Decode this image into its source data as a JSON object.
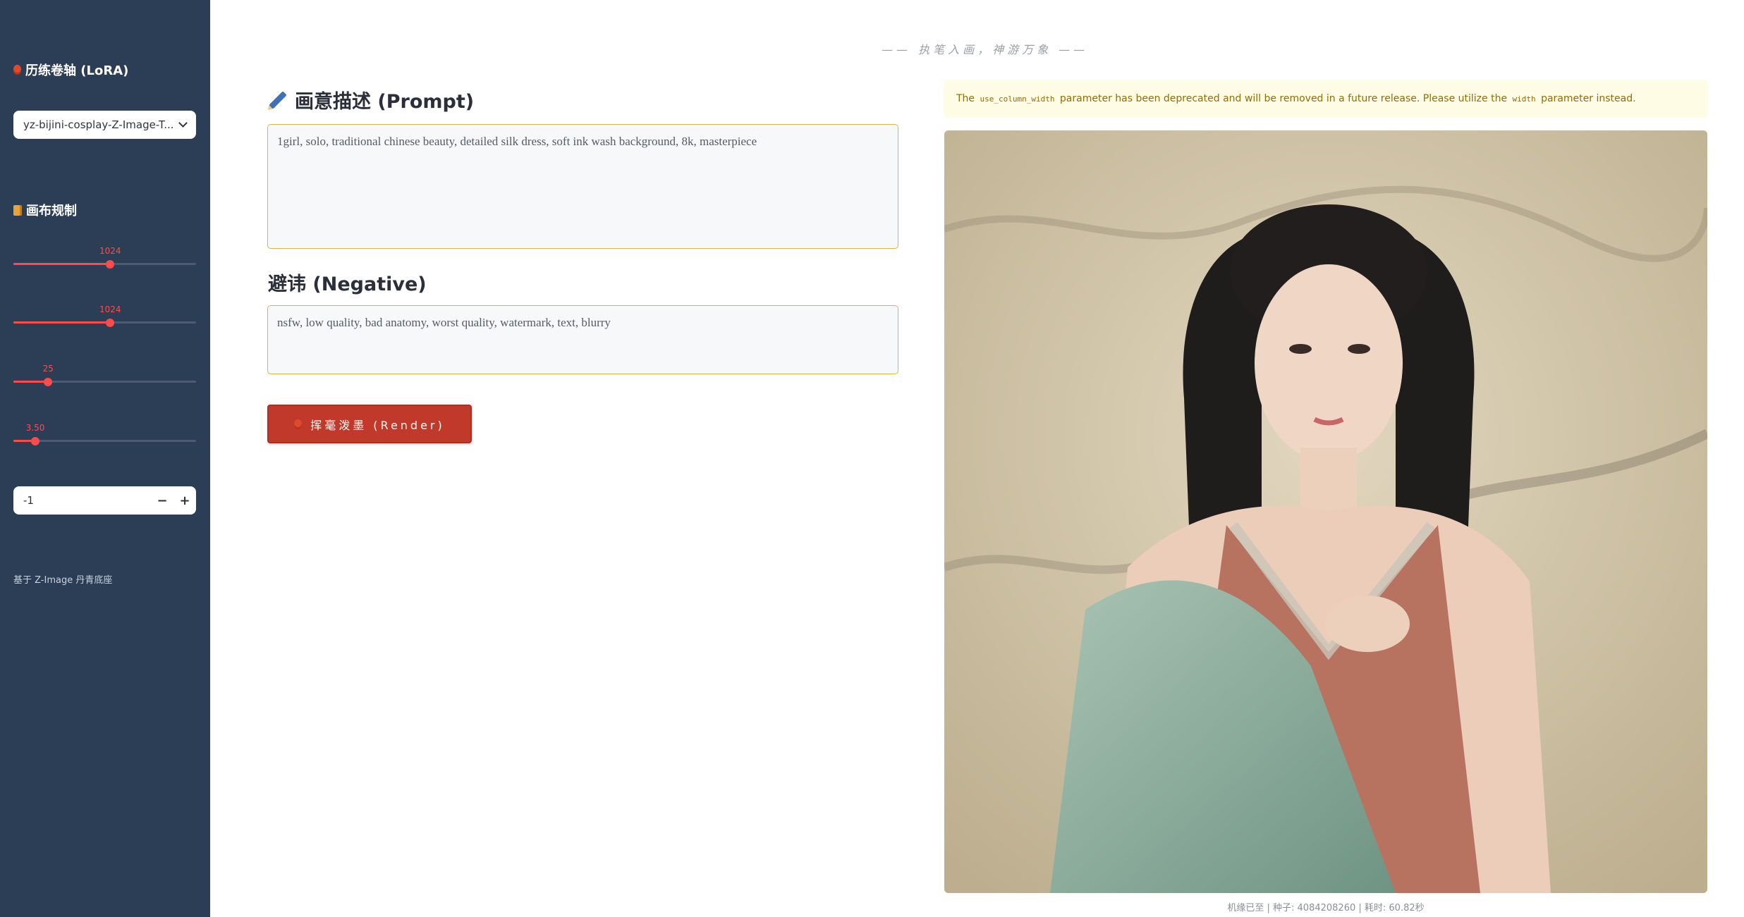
{
  "sidebar": {
    "lora_title": "历练卷轴 (LoRA)",
    "lora_select_value": "yz-bijini-cosplay-Z-Image-T...",
    "canvas_title": "画布规制",
    "sliders": [
      {
        "label": "",
        "value": "1024",
        "fraction": 0.53
      },
      {
        "label": "",
        "value": "1024",
        "fraction": 0.53
      },
      {
        "label": "",
        "value": "25",
        "fraction": 0.19
      },
      {
        "label": "",
        "value": "3.50",
        "fraction": 0.12
      }
    ],
    "seed_label": "",
    "seed_value": "-1",
    "minus": "−",
    "plus": "+",
    "footer": "基于 Z-Image 丹青底座"
  },
  "main": {
    "subtitle": "—— 执笔入画，神游万象 ——",
    "prompt_heading": "画意描述 (Prompt)",
    "prompt_text": "1girl, solo, traditional chinese beauty, detailed silk dress, soft ink wash background, 8k, masterpiece",
    "negative_heading": "避讳 (Negative)",
    "negative_text": "nsfw, low quality, bad anatomy, worst quality, watermark, text, blurry",
    "render_label": "挥毫泼墨 (Render)"
  },
  "output": {
    "warning_pre": "The",
    "warning_code1": "use_column_width",
    "warning_mid": "parameter has been deprecated and will be removed in a future release. Please utilize the",
    "warning_code2": "width",
    "warning_post": "parameter instead.",
    "caption": "机缘已至 | 种子: 4084208260 | 耗时: 60.82秒"
  },
  "colors": {
    "sidebar_bg": "#2c3e55",
    "accent": "#ff4b4b",
    "render_button": "#c0392b",
    "textarea_border": "#e2b24a"
  }
}
